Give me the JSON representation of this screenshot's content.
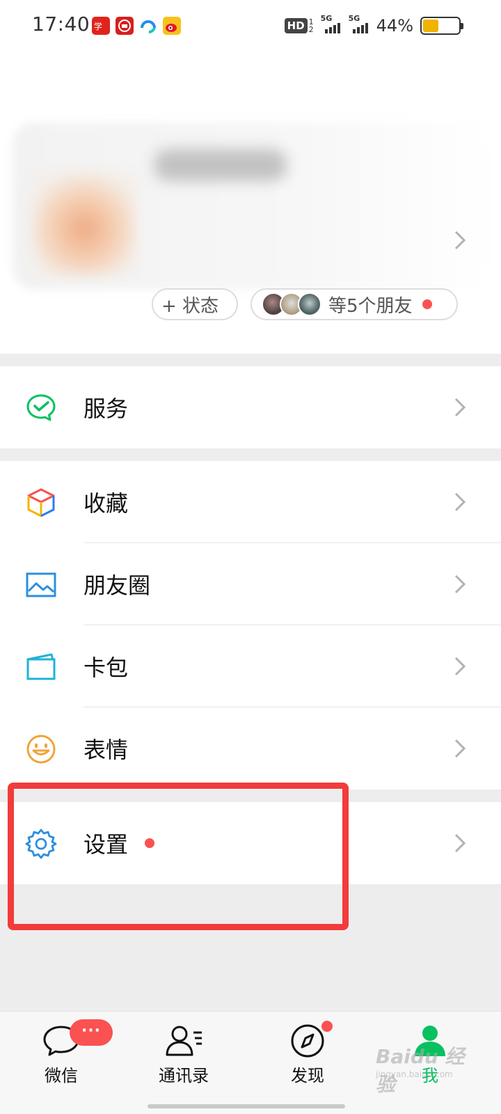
{
  "status_bar": {
    "time": "17:40",
    "app_icons": [
      "xuexi-qiangguo-icon",
      "news-app-icon",
      "browser-app-icon",
      "weibo-icon"
    ],
    "hd_label": "HD",
    "hd_slot_1": "1",
    "hd_slot_2": "2",
    "network_1": "5G",
    "network_2": "5G",
    "battery": "44%",
    "battery_level": 0.44
  },
  "profile": {
    "status_button": "+ 状态",
    "friends_label": "等5个朋友"
  },
  "menu": {
    "services": "服务",
    "favorites": "收藏",
    "moments": "朋友圈",
    "cards": "卡包",
    "stickers": "表情",
    "settings": "设置"
  },
  "tabbar": {
    "chats": "微信",
    "contacts": "通讯录",
    "discover": "发现",
    "me": "我",
    "chats_badge": "···",
    "active_tab": "me"
  },
  "watermark": {
    "brand": "Baidu 经验",
    "url": "jingyan.baidu.com"
  },
  "colors": {
    "wechat_green": "#07c160",
    "badge_red": "#fa5151",
    "highlight_red": "#f33b3b",
    "battery_fill": "#f1b300"
  }
}
